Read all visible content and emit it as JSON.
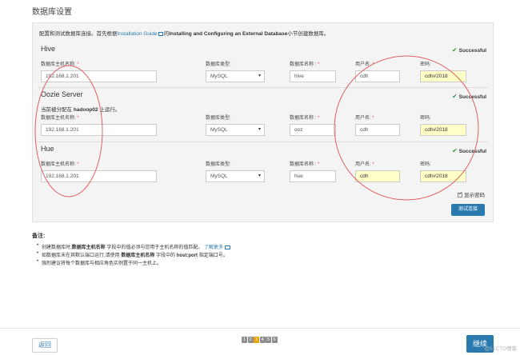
{
  "page_title": "数据库设置",
  "intro": {
    "prefix": "配置和测试数据库连接。首先根据",
    "link": "Installation Guide",
    "middle": "的",
    "bold": "Installing and Configuring an External Database",
    "suffix": "小节创建数据库。"
  },
  "labels": {
    "host": "数据库主机名称:",
    "type": "数据库类型:",
    "name": "数据库名称 :",
    "user": "用户名:",
    "password": "密码:",
    "required": "*"
  },
  "sections": [
    {
      "title": "Hive",
      "status": "Successful",
      "host": "192.168.1.201",
      "type": "MySQL",
      "db_name": "hive",
      "user": "cdh",
      "password": "cdh#2018"
    },
    {
      "title": "Oozie Server",
      "status": "Successful",
      "note_prefix": "当前被分配在",
      "note_host": "hadoop02",
      "note_suffix": "上运行。",
      "host": "192.168.1.201",
      "type": "MySQL",
      "db_name": "ooz",
      "user": "cdh",
      "password": "cdh#2018"
    },
    {
      "title": "Hue",
      "status": "Successful",
      "host": "192.168.1.201",
      "type": "MySQL",
      "db_name": "hue",
      "user": "cdh",
      "password": "cdh#2018"
    }
  ],
  "show_password": "显示密码",
  "test_connection": "测试连接",
  "notes_title": "备注:",
  "notes": [
    {
      "a": "创建数据库时,",
      "b": "数据库主机名称",
      "c": "字段中的值必须与您用于主机名称的值匹配。",
      "link": "了解更多"
    },
    {
      "a": "如数据库未在其默认端口运行,请使用",
      "b": "数据库主机名称",
      "c": "字段中的",
      "d": "host:port",
      "e": "指定端口号。"
    },
    {
      "a": "强烈建议将每个数据库与相应角色实例置于同一主机上。"
    }
  ],
  "footer": {
    "back": "返回",
    "steps": [
      "1",
      "2",
      "3",
      "4",
      "5",
      "6"
    ],
    "active_step": "3",
    "continue": "继续",
    "watermark": "@51CTO博客"
  },
  "colors": {
    "accent": "#2a7ab0",
    "success": "#3a9a3a",
    "required": "#d9534f",
    "highlight_field": "#ffffc8",
    "annotation": "#e06060"
  }
}
